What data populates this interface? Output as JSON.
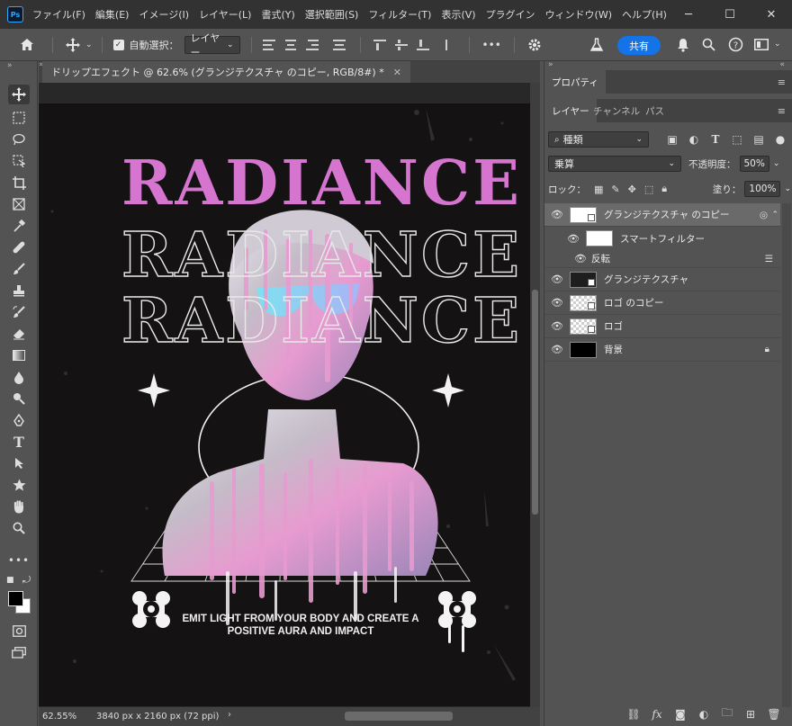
{
  "app": {
    "logo_text": "Ps"
  },
  "menu": [
    "ファイル(F)",
    "編集(E)",
    "イメージ(I)",
    "レイヤー(L)",
    "書式(Y)",
    "選択範囲(S)",
    "フィルター(T)",
    "表示(V)",
    "プラグイン",
    "ウィンドウ(W)",
    "ヘルプ(H)"
  ],
  "window_controls": {
    "minimize": "─",
    "maximize": "☐",
    "close": "✕"
  },
  "options": {
    "auto_select_label": "自動選択：",
    "auto_select_target": "レイヤー",
    "more_label": "•••",
    "share_label": "共有"
  },
  "document": {
    "tab_title": "ドリップエフェクト @ 62.6% (グランジテクスチャ のコピー, RGB/8#) *",
    "close_label": "✕",
    "zoom": "62.55%",
    "dimensions": "3840 px x 2160 px (72 ppi)",
    "status_arrow": "›"
  },
  "artwork": {
    "title_line": "RADIANCE",
    "caption_line1": "EMIT LIGHT FROM YOUR BODY AND CREATE A",
    "caption_line2": "POSITIVE AURA AND IMPACT",
    "colors": {
      "pink": "#d575cf",
      "background": "#141212"
    }
  },
  "panels": {
    "properties_tab": "プロパティ",
    "tabs": [
      "レイヤー",
      "チャンネル",
      "パス"
    ],
    "filter_kind": "種類",
    "blend_mode": "乗算",
    "opacity_label": "不透明度：",
    "opacity_value": "50%",
    "lock_label": "ロック：",
    "fill_label": "塗り：",
    "fill_value": "100%",
    "layers": [
      {
        "name": "グランジテクスチャ のコピー",
        "selected": true,
        "thumb": "white"
      },
      {
        "name": "スマートフィルター",
        "sub": true
      },
      {
        "name": "反転",
        "subsub": true
      },
      {
        "name": "グランジテクスチャ",
        "thumb": "dark"
      },
      {
        "name": "ロゴ のコピー",
        "thumb": "check"
      },
      {
        "name": "ロゴ",
        "thumb": "check"
      },
      {
        "name": "背景",
        "thumb": "black",
        "locked": true
      }
    ]
  }
}
